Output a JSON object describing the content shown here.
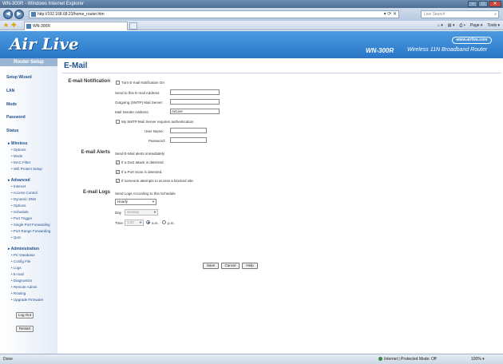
{
  "browser": {
    "window_title": "WN-300R - Windows Internet Explorer",
    "url": "http://192.168.68.23/home_router.htm",
    "search_placeholder": "Live Search",
    "tab_title": "WN-300R",
    "commands": [
      "Page ▾",
      "Tools ▾"
    ],
    "status_left": "Done",
    "status_zone": "Internet | Protected Mode: Off",
    "zoom": "100% ▾"
  },
  "banner": {
    "logo_text": "Air Live",
    "brand_url": "www.airlive.com",
    "model": "WN-300R",
    "tagline": "Wireless 11N Broadband Router"
  },
  "sidebar": {
    "header": "Router Setup",
    "main_items": [
      "Setup Wizard",
      "LAN",
      "Mode",
      "Password",
      "Status"
    ],
    "wireless": {
      "label": "Wireless",
      "items": [
        "Options",
        "Mode",
        "MAC Filter",
        "Wifi Protect Setup"
      ]
    },
    "advanced": {
      "label": "Advanced",
      "items": [
        "Internet",
        "Access Control",
        "Dynamic DNS",
        "Options",
        "Schedule",
        "Port Trigger",
        "Single Port Forwarding",
        "Port Range Forwarding",
        "QoS"
      ]
    },
    "administration": {
      "label": "Administration",
      "items": [
        "PC Database",
        "Config File",
        "Logs",
        "E-mail",
        "Diagnostics",
        "Remote Admin",
        "Routing",
        "Upgrade Firmware"
      ]
    },
    "logout": "Log Out",
    "restart": "Restart"
  },
  "content": {
    "title": "E-Mail",
    "notification": {
      "heading": "E-mail Notification",
      "turn_on_label": "Turn E-mail Notification On",
      "send_to_label": "Send to this E-mail Address:",
      "send_to_value": "",
      "smtp_label": "Outgoing (SMTP) Mail Server:",
      "smtp_value": "",
      "sender_label": "Mail Sender Address:",
      "sender_value": "AirLive",
      "auth_label": "My SMTP Mail Server requires authentication",
      "username_label": "User Name:",
      "username_value": "",
      "password_label": "Password:",
      "password_value": ""
    },
    "alerts": {
      "heading": "E-mail Alerts",
      "intro": "Send E-Mail alerts immediately",
      "items": [
        "If a DoS attack is detected.",
        "If a Port Scan is detected.",
        "If someone attempts to access a blocked site."
      ]
    },
    "logs": {
      "heading": "E-mail Logs",
      "intro": "Send Logs According to this Schedule",
      "frequency": "Hourly",
      "day_label": "Day",
      "day_value": "Sunday",
      "time_label": "Time",
      "time_value": "1:00",
      "am_label": "a.m.",
      "pm_label": "p.m."
    },
    "buttons": {
      "save": "Save",
      "cancel": "Cancel",
      "help": "Help"
    }
  }
}
